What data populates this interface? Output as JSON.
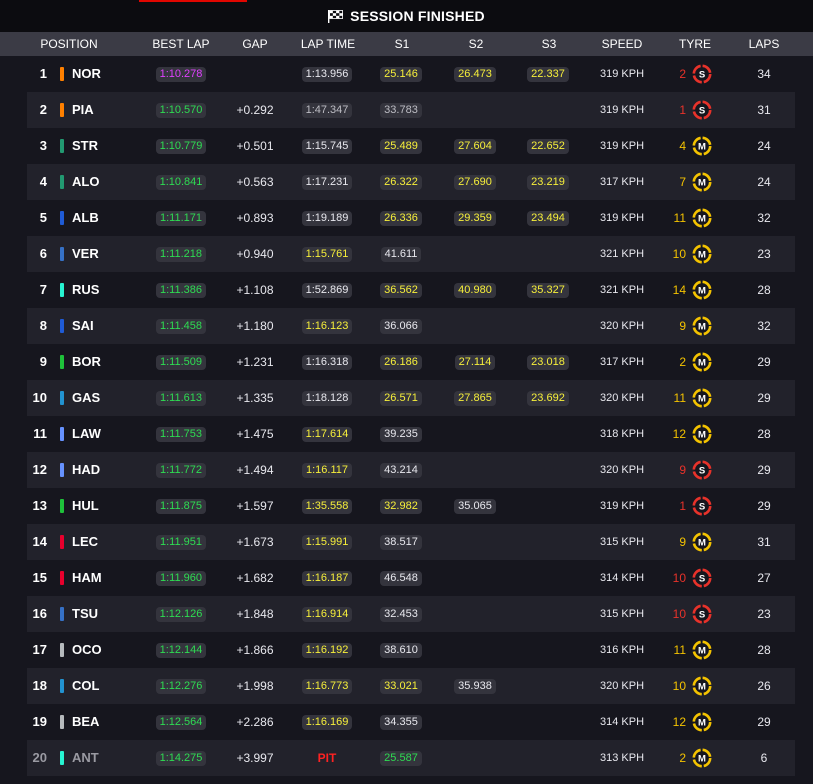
{
  "session": {
    "title": "SESSION FINISHED"
  },
  "columns": {
    "position": "POSITION",
    "best_lap": "BEST LAP",
    "gap": "GAP",
    "lap_time": "LAP TIME",
    "s1": "S1",
    "s2": "S2",
    "s3": "S3",
    "speed": "SPEED",
    "tyre": "TYRE",
    "laps": "LAPS"
  },
  "colors": {
    "green": "#2edc52",
    "purple": "#e040ff",
    "yellow": "#f6ef3a",
    "red": "#ff2222",
    "soft": "#e8322a",
    "medium": "#f4c300",
    "age_medium": "#f4c300",
    "age_soft": "#e8322a"
  },
  "tyre_compound_names": {
    "S": "soft-tyre-icon",
    "M": "medium-tyre-icon"
  },
  "rows": [
    {
      "pos": "1",
      "code": "NOR",
      "team": "#ff8000",
      "best": "1:10.278",
      "best_c": "purple",
      "gap": "",
      "lap": "1:13.956",
      "lap_c": "plain",
      "s1": "25.146",
      "s1_c": "yellow",
      "s2": "26.473",
      "s2_c": "yellow",
      "s3": "22.337",
      "s3_c": "yellow",
      "speed": "319 KPH",
      "age": "2",
      "tyre": "S",
      "laps": "34"
    },
    {
      "pos": "2",
      "code": "PIA",
      "team": "#ff8000",
      "best": "1:10.570",
      "best_c": "green",
      "gap": "+0.292",
      "lap": "1:47.347",
      "lap_c": "grey",
      "s1": "33.783",
      "s1_c": "grey",
      "s2": "",
      "s2_c": "",
      "s3": "",
      "s3_c": "",
      "speed": "319 KPH",
      "age": "1",
      "tyre": "S",
      "laps": "31"
    },
    {
      "pos": "3",
      "code": "STR",
      "team": "#229971",
      "best": "1:10.779",
      "best_c": "green",
      "gap": "+0.501",
      "lap": "1:15.745",
      "lap_c": "plain",
      "s1": "25.489",
      "s1_c": "yellow",
      "s2": "27.604",
      "s2_c": "yellow",
      "s3": "22.652",
      "s3_c": "yellow",
      "speed": "319 KPH",
      "age": "4",
      "tyre": "M",
      "laps": "24"
    },
    {
      "pos": "4",
      "code": "ALO",
      "team": "#229971",
      "best": "1:10.841",
      "best_c": "green",
      "gap": "+0.563",
      "lap": "1:17.231",
      "lap_c": "plain",
      "s1": "26.322",
      "s1_c": "yellow",
      "s2": "27.690",
      "s2_c": "yellow",
      "s3": "23.219",
      "s3_c": "yellow",
      "speed": "317 KPH",
      "age": "7",
      "tyre": "M",
      "laps": "24"
    },
    {
      "pos": "5",
      "code": "ALB",
      "team": "#1f5bd6",
      "best": "1:11.171",
      "best_c": "green",
      "gap": "+0.893",
      "lap": "1:19.189",
      "lap_c": "plain",
      "s1": "26.336",
      "s1_c": "yellow",
      "s2": "29.359",
      "s2_c": "yellow",
      "s3": "23.494",
      "s3_c": "yellow",
      "speed": "319 KPH",
      "age": "11",
      "tyre": "M",
      "laps": "32"
    },
    {
      "pos": "6",
      "code": "VER",
      "team": "#3671c6",
      "best": "1:11.218",
      "best_c": "green",
      "gap": "+0.940",
      "lap": "1:15.761",
      "lap_c": "yellow",
      "s1": "41.611",
      "s1_c": "plain",
      "s2": "",
      "s2_c": "",
      "s3": "",
      "s3_c": "",
      "speed": "321 KPH",
      "age": "10",
      "tyre": "M",
      "laps": "23"
    },
    {
      "pos": "7",
      "code": "RUS",
      "team": "#27f4d2",
      "best": "1:11.386",
      "best_c": "green",
      "gap": "+1.108",
      "lap": "1:52.869",
      "lap_c": "plain",
      "s1": "36.562",
      "s1_c": "yellow",
      "s2": "40.980",
      "s2_c": "yellow",
      "s3": "35.327",
      "s3_c": "yellow",
      "speed": "321 KPH",
      "age": "14",
      "tyre": "M",
      "laps": "28"
    },
    {
      "pos": "8",
      "code": "SAI",
      "team": "#1f5bd6",
      "best": "1:11.458",
      "best_c": "green",
      "gap": "+1.180",
      "lap": "1:16.123",
      "lap_c": "yellow",
      "s1": "36.066",
      "s1_c": "plain",
      "s2": "",
      "s2_c": "",
      "s3": "",
      "s3_c": "",
      "speed": "320 KPH",
      "age": "9",
      "tyre": "M",
      "laps": "32"
    },
    {
      "pos": "9",
      "code": "BOR",
      "team": "#1ec13a",
      "best": "1:11.509",
      "best_c": "green",
      "gap": "+1.231",
      "lap": "1:16.318",
      "lap_c": "plain",
      "s1": "26.186",
      "s1_c": "yellow",
      "s2": "27.114",
      "s2_c": "yellow",
      "s3": "23.018",
      "s3_c": "yellow",
      "speed": "317 KPH",
      "age": "2",
      "tyre": "M",
      "laps": "29"
    },
    {
      "pos": "10",
      "code": "GAS",
      "team": "#2293d1",
      "best": "1:11.613",
      "best_c": "green",
      "gap": "+1.335",
      "lap": "1:18.128",
      "lap_c": "plain",
      "s1": "26.571",
      "s1_c": "yellow",
      "s2": "27.865",
      "s2_c": "yellow",
      "s3": "23.692",
      "s3_c": "yellow",
      "speed": "320 KPH",
      "age": "11",
      "tyre": "M",
      "laps": "29"
    },
    {
      "pos": "11",
      "code": "LAW",
      "team": "#6692ff",
      "best": "1:11.753",
      "best_c": "green",
      "gap": "+1.475",
      "lap": "1:17.614",
      "lap_c": "yellow",
      "s1": "39.235",
      "s1_c": "plain",
      "s2": "",
      "s2_c": "",
      "s3": "",
      "s3_c": "",
      "speed": "318 KPH",
      "age": "12",
      "tyre": "M",
      "laps": "28"
    },
    {
      "pos": "12",
      "code": "HAD",
      "team": "#6692ff",
      "best": "1:11.772",
      "best_c": "green",
      "gap": "+1.494",
      "lap": "1:16.117",
      "lap_c": "yellow",
      "s1": "43.214",
      "s1_c": "plain",
      "s2": "",
      "s2_c": "",
      "s3": "",
      "s3_c": "",
      "speed": "320 KPH",
      "age": "9",
      "tyre": "S",
      "laps": "29"
    },
    {
      "pos": "13",
      "code": "HUL",
      "team": "#1ec13a",
      "best": "1:11.875",
      "best_c": "green",
      "gap": "+1.597",
      "lap": "1:35.558",
      "lap_c": "yellow",
      "s1": "32.982",
      "s1_c": "yellow",
      "s2": "35.065",
      "s2_c": "plain",
      "s3": "",
      "s3_c": "",
      "speed": "319 KPH",
      "age": "1",
      "tyre": "S",
      "laps": "29"
    },
    {
      "pos": "14",
      "code": "LEC",
      "team": "#e8002d",
      "best": "1:11.951",
      "best_c": "green",
      "gap": "+1.673",
      "lap": "1:15.991",
      "lap_c": "yellow",
      "s1": "38.517",
      "s1_c": "plain",
      "s2": "",
      "s2_c": "",
      "s3": "",
      "s3_c": "",
      "speed": "315 KPH",
      "age": "9",
      "tyre": "M",
      "laps": "31"
    },
    {
      "pos": "15",
      "code": "HAM",
      "team": "#e8002d",
      "best": "1:11.960",
      "best_c": "green",
      "gap": "+1.682",
      "lap": "1:16.187",
      "lap_c": "yellow",
      "s1": "46.548",
      "s1_c": "plain",
      "s2": "",
      "s2_c": "",
      "s3": "",
      "s3_c": "",
      "speed": "314 KPH",
      "age": "10",
      "tyre": "S",
      "laps": "27"
    },
    {
      "pos": "16",
      "code": "TSU",
      "team": "#3671c6",
      "best": "1:12.126",
      "best_c": "green",
      "gap": "+1.848",
      "lap": "1:16.914",
      "lap_c": "yellow",
      "s1": "32.453",
      "s1_c": "plain",
      "s2": "",
      "s2_c": "",
      "s3": "",
      "s3_c": "",
      "speed": "315 KPH",
      "age": "10",
      "tyre": "S",
      "laps": "23"
    },
    {
      "pos": "17",
      "code": "OCO",
      "team": "#b6babd",
      "best": "1:12.144",
      "best_c": "green",
      "gap": "+1.866",
      "lap": "1:16.192",
      "lap_c": "yellow",
      "s1": "38.610",
      "s1_c": "plain",
      "s2": "",
      "s2_c": "",
      "s3": "",
      "s3_c": "",
      "speed": "316 KPH",
      "age": "11",
      "tyre": "M",
      "laps": "28"
    },
    {
      "pos": "18",
      "code": "COL",
      "team": "#2293d1",
      "best": "1:12.276",
      "best_c": "green",
      "gap": "+1.998",
      "lap": "1:16.773",
      "lap_c": "yellow",
      "s1": "33.021",
      "s1_c": "yellow",
      "s2": "35.938",
      "s2_c": "plain",
      "s3": "",
      "s3_c": "",
      "speed": "320 KPH",
      "age": "10",
      "tyre": "M",
      "laps": "26"
    },
    {
      "pos": "19",
      "code": "BEA",
      "team": "#b6babd",
      "best": "1:12.564",
      "best_c": "green",
      "gap": "+2.286",
      "lap": "1:16.169",
      "lap_c": "yellow",
      "s1": "34.355",
      "s1_c": "plain",
      "s2": "",
      "s2_c": "",
      "s3": "",
      "s3_c": "",
      "speed": "314 KPH",
      "age": "12",
      "tyre": "M",
      "laps": "29"
    },
    {
      "pos": "20",
      "code": "ANT",
      "team": "#27f4d2",
      "best": "1:14.275",
      "best_c": "green",
      "gap": "+3.997",
      "lap": "PIT",
      "lap_c": "pit",
      "s1": "25.587",
      "s1_c": "green",
      "s2": "",
      "s2_c": "",
      "s3": "",
      "s3_c": "",
      "speed": "313 KPH",
      "age": "2",
      "tyre": "M",
      "laps": "6",
      "dimmed": true
    }
  ]
}
